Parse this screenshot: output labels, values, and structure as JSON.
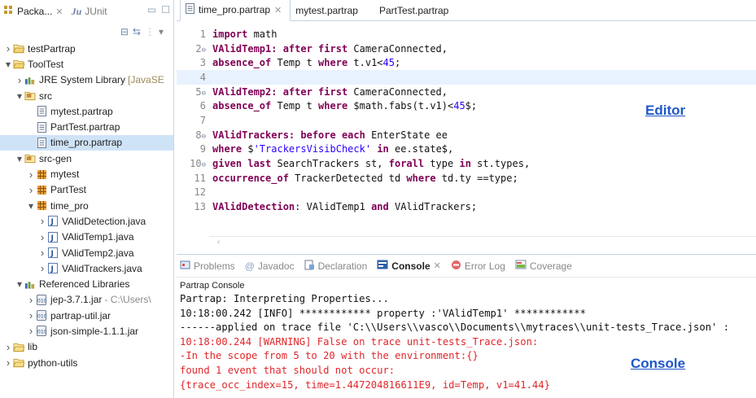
{
  "left_panel": {
    "tabs": [
      {
        "label": "Packa...",
        "icon": "package-explorer-icon",
        "active": true
      },
      {
        "label": "JUnit",
        "prefix": "Ju",
        "icon": "junit-icon",
        "active": false
      }
    ],
    "tree": [
      {
        "label": "testPartrap",
        "icon": "project-icon",
        "depth": 0,
        "expand": "collapsed"
      },
      {
        "label": "ToolTest",
        "icon": "project-icon",
        "depth": 0,
        "expand": "expanded"
      },
      {
        "label": "JRE System Library",
        "decoration": "[JavaSE",
        "icon": "library-icon",
        "depth": 1,
        "expand": "collapsed"
      },
      {
        "label": "src",
        "icon": "source-folder-icon",
        "depth": 1,
        "expand": "expanded"
      },
      {
        "label": "mytest.partrap",
        "icon": "file-icon",
        "depth": 2,
        "expand": "none"
      },
      {
        "label": "PartTest.partrap",
        "icon": "file-icon",
        "depth": 2,
        "expand": "none"
      },
      {
        "label": "time_pro.partrap",
        "icon": "file-icon",
        "depth": 2,
        "expand": "none",
        "selected": true
      },
      {
        "label": "src-gen",
        "icon": "source-folder-icon",
        "depth": 1,
        "expand": "expanded"
      },
      {
        "label": "mytest",
        "icon": "package-icon",
        "depth": 2,
        "expand": "collapsed"
      },
      {
        "label": "PartTest",
        "icon": "package-icon",
        "depth": 2,
        "expand": "collapsed"
      },
      {
        "label": "time_pro",
        "icon": "package-icon",
        "depth": 2,
        "expand": "expanded"
      },
      {
        "label": "VAlidDetection.java",
        "icon": "java-file-icon",
        "depth": 3,
        "expand": "collapsed"
      },
      {
        "label": "VAlidTemp1.java",
        "icon": "java-file-icon",
        "depth": 3,
        "expand": "collapsed"
      },
      {
        "label": "VAlidTemp2.java",
        "icon": "java-file-icon",
        "depth": 3,
        "expand": "collapsed"
      },
      {
        "label": "VAlidTrackers.java",
        "icon": "java-file-icon",
        "depth": 3,
        "expand": "collapsed"
      },
      {
        "label": "Referenced Libraries",
        "icon": "library-icon",
        "depth": 1,
        "expand": "expanded"
      },
      {
        "label": "jep-3.7.1.jar",
        "decoration": "- C:\\Users\\",
        "icon": "jar-icon",
        "depth": 2,
        "expand": "collapsed"
      },
      {
        "label": "partrap-util.jar",
        "icon": "jar-icon",
        "depth": 2,
        "expand": "collapsed"
      },
      {
        "label": "json-simple-1.1.1.jar",
        "icon": "jar-icon",
        "depth": 2,
        "expand": "collapsed"
      },
      {
        "label": "lib",
        "icon": "folder-icon",
        "depth": 0,
        "expand": "collapsed"
      },
      {
        "label": "python-utils",
        "icon": "folder-icon",
        "depth": 0,
        "expand": "collapsed"
      }
    ]
  },
  "editor": {
    "tabs": [
      {
        "label": "time_pro.partrap",
        "active": true,
        "closable": true
      },
      {
        "label": "mytest.partrap",
        "active": false
      },
      {
        "label": "PartTest.partrap",
        "active": false
      }
    ],
    "lines": [
      {
        "n": "1",
        "fold": false,
        "tokens": [
          {
            "t": "import",
            "c": "kw"
          },
          {
            "t": " math",
            "c": "plain"
          }
        ]
      },
      {
        "n": "2",
        "fold": true,
        "tokens": [
          {
            "t": "VAlidTemp1: after first",
            "c": "kw"
          },
          {
            "t": " CameraConnected,",
            "c": "plain"
          }
        ]
      },
      {
        "n": "3",
        "fold": false,
        "tokens": [
          {
            "t": "absence_of",
            "c": "kw"
          },
          {
            "t": " Temp t ",
            "c": "plain"
          },
          {
            "t": "where",
            "c": "kw"
          },
          {
            "t": " t.v1<",
            "c": "plain"
          },
          {
            "t": "45",
            "c": "num"
          },
          {
            "t": ";",
            "c": "plain"
          }
        ]
      },
      {
        "n": "4",
        "fold": false,
        "highlight": true,
        "tokens": []
      },
      {
        "n": "5",
        "fold": true,
        "tokens": [
          {
            "t": "VAlidTemp2: after first",
            "c": "kw"
          },
          {
            "t": " CameraConnected,",
            "c": "plain"
          }
        ]
      },
      {
        "n": "6",
        "fold": false,
        "tokens": [
          {
            "t": "absence_of",
            "c": "kw"
          },
          {
            "t": " Temp t ",
            "c": "plain"
          },
          {
            "t": "where",
            "c": "kw"
          },
          {
            "t": " $math.fabs(t.v1)<",
            "c": "plain"
          },
          {
            "t": "45",
            "c": "num"
          },
          {
            "t": "$;",
            "c": "plain"
          }
        ]
      },
      {
        "n": "7",
        "fold": false,
        "tokens": []
      },
      {
        "n": "8",
        "fold": true,
        "tokens": [
          {
            "t": "VAlidTrackers: before each",
            "c": "kw"
          },
          {
            "t": " EnterState ee",
            "c": "plain"
          }
        ]
      },
      {
        "n": "9",
        "fold": false,
        "tokens": [
          {
            "t": "where",
            "c": "kw"
          },
          {
            "t": " $",
            "c": "plain"
          },
          {
            "t": "'TrackersVisibCheck'",
            "c": "str"
          },
          {
            "t": " ",
            "c": "plain"
          },
          {
            "t": "in",
            "c": "kw"
          },
          {
            "t": " ee.state$,",
            "c": "plain"
          }
        ]
      },
      {
        "n": "10",
        "fold": true,
        "tokens": [
          {
            "t": "given last",
            "c": "kw"
          },
          {
            "t": " SearchTrackers st, ",
            "c": "plain"
          },
          {
            "t": "forall",
            "c": "kw"
          },
          {
            "t": " type ",
            "c": "plain"
          },
          {
            "t": "in",
            "c": "kw"
          },
          {
            "t": " st.types,",
            "c": "plain"
          }
        ]
      },
      {
        "n": "11",
        "fold": false,
        "tokens": [
          {
            "t": "occurrence_of",
            "c": "kw"
          },
          {
            "t": " TrackerDetected td ",
            "c": "plain"
          },
          {
            "t": "where",
            "c": "kw"
          },
          {
            "t": " td.ty ==type;",
            "c": "plain"
          }
        ]
      },
      {
        "n": "12",
        "fold": false,
        "tokens": []
      },
      {
        "n": "13",
        "fold": false,
        "tokens": [
          {
            "t": "VAlidDetection",
            "c": "kw"
          },
          {
            "t": ": VAlidTemp1 ",
            "c": "plain"
          },
          {
            "t": "and",
            "c": "kw"
          },
          {
            "t": " VAlidTrackers;",
            "c": "plain"
          }
        ]
      }
    ],
    "annotation": "Editor"
  },
  "bottom_panel": {
    "tabs": [
      {
        "label": "Problems",
        "icon": "problems-icon",
        "active": false
      },
      {
        "label": "Javadoc",
        "icon": "javadoc-icon",
        "prefix": "@",
        "active": false
      },
      {
        "label": "Declaration",
        "icon": "declaration-icon",
        "active": false
      },
      {
        "label": "Console",
        "icon": "console-icon",
        "active": true,
        "closable": true
      },
      {
        "label": "Error Log",
        "icon": "error-log-icon",
        "active": false
      },
      {
        "label": "Coverage",
        "icon": "coverage-icon",
        "active": false
      }
    ],
    "console_label": "Partrap Console",
    "output": [
      {
        "text": "Partrap: Interpreting Properties...",
        "color": "black"
      },
      {
        "text": "10:18:00.242 [INFO] ************ property :'VAlidTemp1' ************",
        "color": "black"
      },
      {
        "text": "------applied on trace file 'C:\\\\Users\\\\vasco\\\\Documents\\\\mytraces\\\\unit-tests_Trace.json' :",
        "color": "black"
      },
      {
        "text": "10:18:00.244 [WARNING] False on trace unit-tests_Trace.json:",
        "color": "red"
      },
      {
        "text": "-In the scope from 5 to 20 with the environment:{}",
        "color": "red"
      },
      {
        "text": "found 1 event that should not occur:",
        "color": "red"
      },
      {
        "text": "{trace_occ_index=15, time=1.447204816611E9, id=Temp, v1=41.44}",
        "color": "red"
      }
    ],
    "annotation": "Console"
  }
}
